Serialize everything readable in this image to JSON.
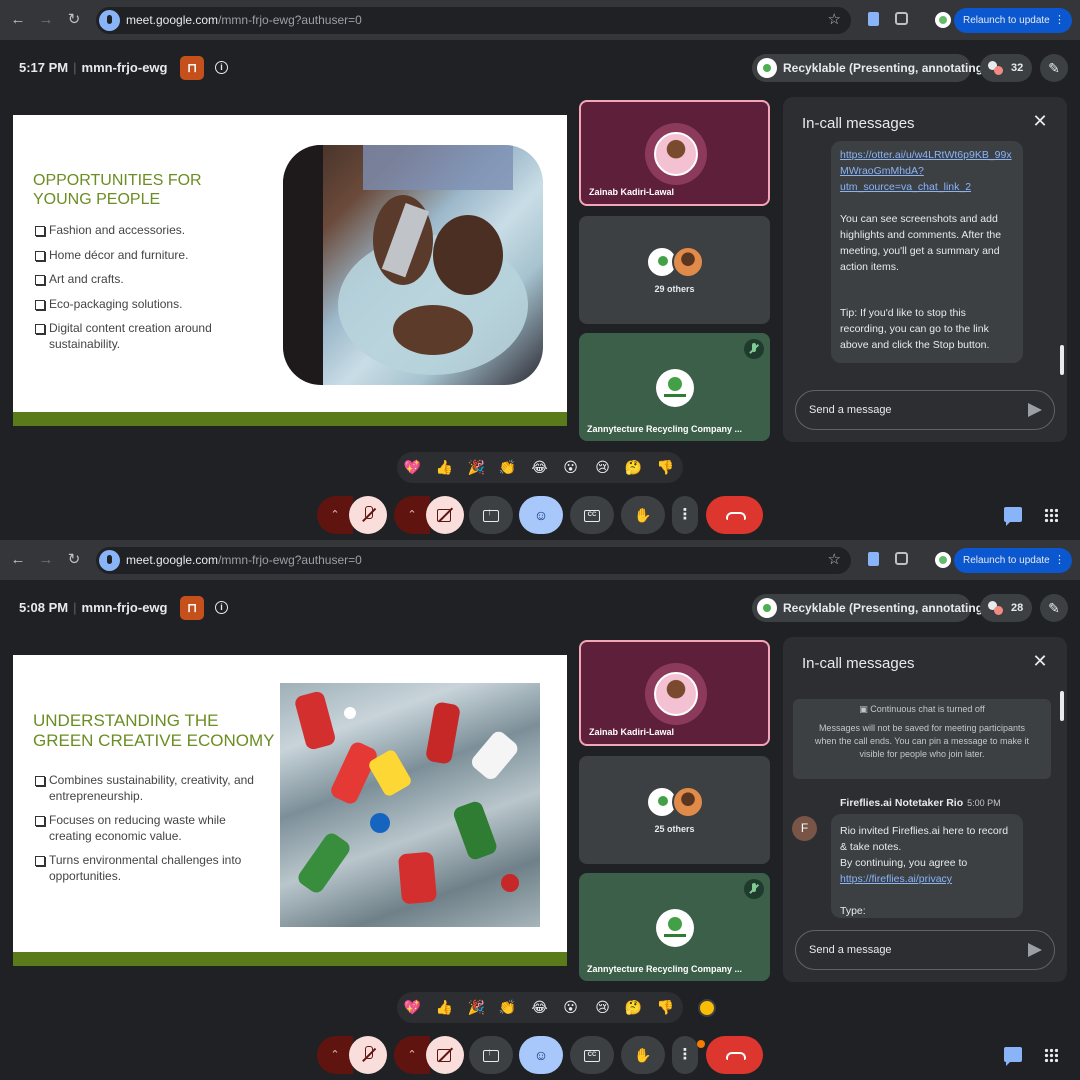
{
  "browser": {
    "url_host": "meet.google.com",
    "url_path": "/mmn-frjo-ewg?authuser=0",
    "relaunch_label": "Relaunch to update"
  },
  "meeting": {
    "code": "mmn-frjo-ewg",
    "presenter_chip": "Recyklable (Presenting, annotating)"
  },
  "tiles": {
    "zainab": "Zainab Kadiri-Lawal",
    "company": "Zannytecture Recycling Company ..."
  },
  "chat": {
    "title": "In-call messages",
    "input_placeholder": "Send a message"
  },
  "reactions": [
    "💖",
    "👍",
    "🎉",
    "👏",
    "😂",
    "😮",
    "😢",
    "🤔",
    "👎"
  ],
  "top": {
    "time": "5:17 PM",
    "participant_count": "32",
    "others_label": "29 others",
    "slide": {
      "title_line1": "OPPORTUNITIES FOR",
      "title_line2": "YOUNG PEOPLE",
      "bullets": [
        "Fashion and accessories.",
        "Home décor and furniture.",
        "Art and crafts.",
        "Eco-packaging solutions.",
        "Digital content creation around sustainability."
      ]
    },
    "chat": {
      "link_line1": "https://otter.ai/u/w4LRtWt6p9KB_99x",
      "link_line2": "MWraoGmMhdA?",
      "link_line3": "utm_source=va_chat_link_2",
      "para1": "You can see screenshots and add highlights and comments. After the meeting, you'll get a summary and action items.",
      "para2": "Tip: If you'd like to stop this recording, you can go to the link above and click the Stop button."
    }
  },
  "bottom": {
    "time": "5:08 PM",
    "participant_count": "28",
    "others_label": "25 others",
    "slide": {
      "title_line1": "UNDERSTANDING THE",
      "title_line2": "GREEN CREATIVE ECONOMY",
      "bullets": [
        "Combines sustainability, creativity, and entrepreneurship.",
        "Focuses on reducing waste while creating economic value.",
        "Turns environmental challenges into opportunities."
      ]
    },
    "chat": {
      "system_head": "Continuous chat is turned off",
      "system_body": "Messages will not be saved for meeting participants when the call ends. You can pin a message to make it visible for people who join later.",
      "sender_name": "Fireflies.ai Notetaker Rio",
      "sender_time": "5:00 PM",
      "sender_initial": "F",
      "msg_line1": "Rio invited Fireflies.ai here to record & take notes.",
      "msg_line2": "By continuing, you agree to",
      "msg_link": "https://fireflies.ai/privacy",
      "msg_line3": "Type:"
    }
  }
}
